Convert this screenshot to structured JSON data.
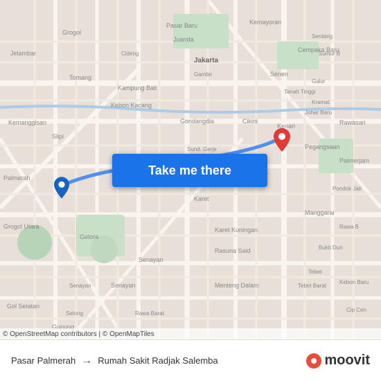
{
  "map": {
    "button_label": "Take me there",
    "attribution": "© OpenStreetMap contributors | © OpenMapTiles",
    "pin_colors": {
      "destination": "#e53935",
      "origin": "#1565c0"
    }
  },
  "bottom_bar": {
    "origin": "Pasar Palmerah",
    "destination": "Rumah Sakit Radjak Salemba",
    "arrow": "→",
    "brand": "moovit"
  }
}
